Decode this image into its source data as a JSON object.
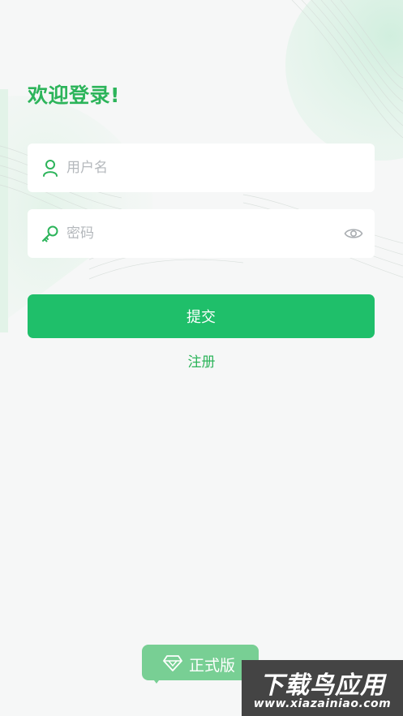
{
  "login": {
    "welcome_title": "欢迎登录!",
    "username": {
      "placeholder": "用户名",
      "value": "",
      "icon": "user-icon"
    },
    "password": {
      "placeholder": "密码",
      "value": "",
      "icon": "key-icon",
      "toggle_icon": "eye-icon"
    },
    "submit_label": "提交",
    "register_label": "注册"
  },
  "badge": {
    "label": "正式版",
    "icon": "diamond-icon"
  },
  "watermark": {
    "title": "下载鸟应用",
    "url": "www.xiazainiao.com"
  },
  "colors": {
    "accent": "#1fbf6a",
    "title_green": "#2cb45a",
    "background": "#f6f7f7",
    "badge": "#78cf94",
    "placeholder": "#b4b8bc"
  }
}
